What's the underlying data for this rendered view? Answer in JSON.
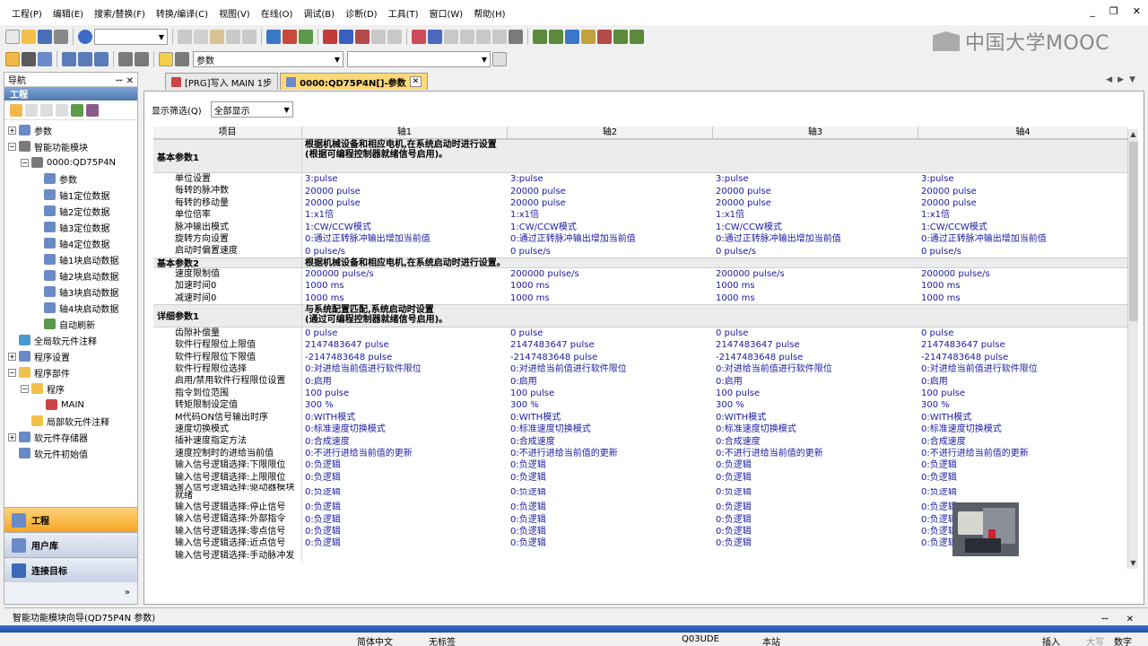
{
  "menubar": {
    "items": [
      "工程(P)",
      "编辑(E)",
      "搜索/替换(F)",
      "转换/编译(C)",
      "视图(V)",
      "在线(O)",
      "调试(B)",
      "诊断(D)",
      "工具(T)",
      "窗口(W)",
      "帮助(H)"
    ]
  },
  "toolbar": {
    "row1_combo_value": "",
    "row2_combo_value": "参数"
  },
  "logo": {
    "text": "中国大学MOOC"
  },
  "nav": {
    "title": "导航",
    "subtitle": "工程",
    "tree": [
      {
        "label": "参数"
      },
      {
        "label": "智能功能模块"
      },
      {
        "label": "0000:QD75P4N"
      },
      {
        "label": "参数"
      },
      {
        "label": "轴1定位数据"
      },
      {
        "label": "轴2定位数据"
      },
      {
        "label": "轴3定位数据"
      },
      {
        "label": "轴4定位数据"
      },
      {
        "label": "轴1块启动数据"
      },
      {
        "label": "轴2块启动数据"
      },
      {
        "label": "轴3块启动数据"
      },
      {
        "label": "轴4块启动数据"
      },
      {
        "label": "自动刷新"
      },
      {
        "label": "全局软元件注释"
      },
      {
        "label": "程序设置"
      },
      {
        "label": "程序部件"
      },
      {
        "label": "程序"
      },
      {
        "label": "MAIN"
      },
      {
        "label": "局部软元件注释"
      },
      {
        "label": "软元件存储器"
      },
      {
        "label": "软元件初始值"
      }
    ],
    "categories": [
      {
        "label": "工程"
      },
      {
        "label": "用户库"
      },
      {
        "label": "连接目标"
      }
    ]
  },
  "tabs": [
    {
      "label": "[PRG]写入 MAIN 1步"
    },
    {
      "label": "0000:QD75P4N[]-参数"
    }
  ],
  "filter": {
    "label": "显示筛选(Q)",
    "value": "全部显示"
  },
  "grid": {
    "headers": [
      "项目",
      "轴1",
      "轴2",
      "轴3",
      "轴4"
    ],
    "sections": [
      {
        "title": "基本参数1",
        "desc": "根据机械设备和相应电机,在系统启动时进行设置\n(根据可编程控制器就绪信号启用)。",
        "rows": [
          {
            "name": "单位设置",
            "values": [
              "3:pulse",
              "3:pulse",
              "3:pulse",
              "3:pulse"
            ]
          },
          {
            "name": "每转的脉冲数",
            "values": [
              "20000 pulse",
              "20000 pulse",
              "20000 pulse",
              "20000 pulse"
            ]
          },
          {
            "name": "每转的移动量",
            "values": [
              "20000 pulse",
              "20000 pulse",
              "20000 pulse",
              "20000 pulse"
            ]
          },
          {
            "name": "单位倍率",
            "values": [
              "1:x1倍",
              "1:x1倍",
              "1:x1倍",
              "1:x1倍"
            ]
          },
          {
            "name": "脉冲输出模式",
            "values": [
              "1:CW/CCW模式",
              "1:CW/CCW模式",
              "1:CW/CCW模式",
              "1:CW/CCW模式"
            ]
          },
          {
            "name": "旋转方向设置",
            "values": [
              "0:通过正转脉冲输出增加当前值",
              "0:通过正转脉冲输出增加当前值",
              "0:通过正转脉冲输出增加当前值",
              "0:通过正转脉冲输出增加当前值"
            ]
          },
          {
            "name": "启动时偏置速度",
            "values": [
              "0 pulse/s",
              "0 pulse/s",
              "0 pulse/s",
              "0 pulse/s"
            ]
          }
        ]
      },
      {
        "title": "基本参数2",
        "desc": "根据机械设备和相应电机,在系统启动时进行设置。",
        "rows": [
          {
            "name": "速度限制值",
            "values": [
              "200000 pulse/s",
              "200000 pulse/s",
              "200000 pulse/s",
              "200000 pulse/s"
            ]
          },
          {
            "name": "加速时间0",
            "values": [
              "1000 ms",
              "1000 ms",
              "1000 ms",
              "1000 ms"
            ]
          },
          {
            "name": "减速时间0",
            "values": [
              "1000 ms",
              "1000 ms",
              "1000 ms",
              "1000 ms"
            ]
          }
        ]
      },
      {
        "title": "详细参数1",
        "desc": "与系统配置匹配,系统启动时设置\n(通过可编程控制器就绪信号启用)。",
        "rows": [
          {
            "name": "齿隙补偿量",
            "values": [
              "0 pulse",
              "0 pulse",
              "0 pulse",
              "0 pulse"
            ]
          },
          {
            "name": "软件行程限位上限值",
            "values": [
              "2147483647 pulse",
              "2147483647 pulse",
              "2147483647 pulse",
              "2147483647 pulse"
            ]
          },
          {
            "name": "软件行程限位下限值",
            "values": [
              "-2147483648 pulse",
              "-2147483648 pulse",
              "-2147483648 pulse",
              "-2147483648 pulse"
            ]
          },
          {
            "name": "软件行程限位选择",
            "values": [
              "0:对进给当前值进行软件限位",
              "0:对进给当前值进行软件限位",
              "0:对进给当前值进行软件限位",
              "0:对进给当前值进行软件限位"
            ]
          },
          {
            "name": "启用/禁用软件行程限位设置",
            "values": [
              "0:启用",
              "0:启用",
              "0:启用",
              "0:启用"
            ]
          },
          {
            "name": "指令到位范围",
            "values": [
              "100 pulse",
              "100 pulse",
              "100 pulse",
              "100 pulse"
            ]
          },
          {
            "name": "转矩限制设定值",
            "values": [
              "300 %",
              "300 %",
              "300 %",
              "300 %"
            ]
          },
          {
            "name": "M代码ON信号输出时序",
            "values": [
              "0:WITH模式",
              "0:WITH模式",
              "0:WITH模式",
              "0:WITH模式"
            ]
          },
          {
            "name": "速度切换模式",
            "values": [
              "0:标准速度切换模式",
              "0:标准速度切换模式",
              "0:标准速度切换模式",
              "0:标准速度切换模式"
            ]
          },
          {
            "name": "插补速度指定方法",
            "values": [
              "0:合成速度",
              "0:合成速度",
              "0:合成速度",
              "0:合成速度"
            ]
          },
          {
            "name": "速度控制时的进给当前值",
            "values": [
              "0:不进行进给当前值的更新",
              "0:不进行进给当前值的更新",
              "0:不进行进给当前值的更新",
              "0:不进行进给当前值的更新"
            ]
          },
          {
            "name": "输入信号逻辑选择:下限限位",
            "values": [
              "0:负逻辑",
              "0:负逻辑",
              "0:负逻辑",
              "0:负逻辑"
            ]
          },
          {
            "name": "输入信号逻辑选择:上限限位",
            "values": [
              "0:负逻辑",
              "0:负逻辑",
              "0:负逻辑",
              "0:负逻辑"
            ]
          },
          {
            "name": "输入信号逻辑选择:驱动器模块就绪",
            "values": [
              "0:负逻辑",
              "0:负逻辑",
              "0:负逻辑",
              "0:负逻辑"
            ]
          },
          {
            "name": "输入信号逻辑选择:停止信号",
            "values": [
              "0:负逻辑",
              "0:负逻辑",
              "0:负逻辑",
              "0:负逻辑"
            ]
          },
          {
            "name": "输入信号逻辑选择:外部指令",
            "values": [
              "0:负逻辑",
              "0:负逻辑",
              "0:负逻辑",
              "0:负逻辑"
            ]
          },
          {
            "name": "输入信号逻辑选择:零点信号",
            "values": [
              "0:负逻辑",
              "0:负逻辑",
              "0:负逻辑",
              "0:负逻辑"
            ]
          },
          {
            "name": "输入信号逻辑选择:近点信号",
            "values": [
              "0:负逻辑",
              "0:负逻辑",
              "0:负逻辑",
              "0:负逻辑"
            ]
          },
          {
            "name": "输入信号逻辑选择:手动脉冲发",
            "values": [
              "",
              "",
              "",
              ""
            ]
          }
        ]
      }
    ]
  },
  "wizard": {
    "title": "智能功能模块向导(QD75P4N 参数)"
  },
  "statusbar": {
    "lang": "简体中文",
    "title": "无标签",
    "cpu": "Q03UDE",
    "station": "本站",
    "mode": "插入",
    "caps": "大写",
    "num": "数字"
  },
  "colors": {
    "accent": "#ffd978",
    "nav_active": "#f5a623",
    "value_text": "#1a1aa0",
    "bluebar": "#1f4fa8"
  }
}
